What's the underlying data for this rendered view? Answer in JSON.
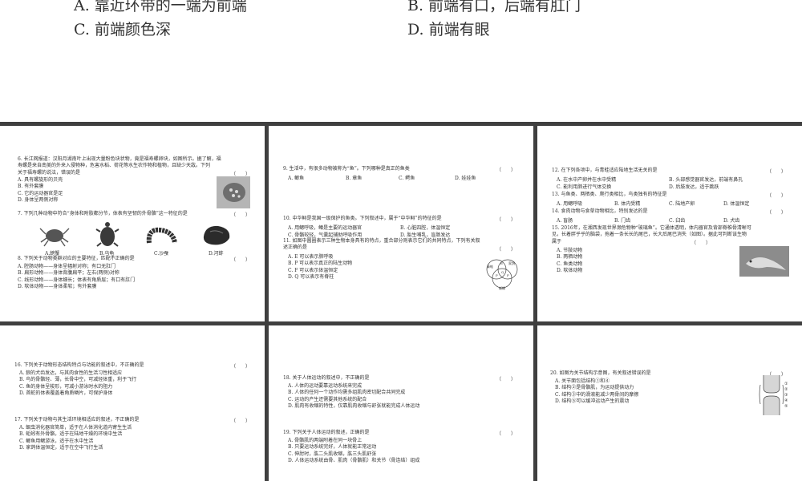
{
  "top": {
    "option_a": "A. 靠近环带的一端为前端",
    "option_b": "B. 前端有口，后端有肛门",
    "option_c": "C. 前端颜色深",
    "option_d": "D. 前端有眼"
  },
  "p1": {
    "q6": {
      "stem": [
        "6. 长江网报道：汉阳月湖南叶上出现大量粉色块状物，竟是福寿螺卵块，如图所示。据了解，福",
        "寿螺是来自南美的外来入侵物种，危害水稻、荷花等水生农作物和植物，且缺少天敌。下列",
        "关于福寿螺的说法，错误的是"
      ],
      "paren": "（　　）",
      "options": [
        "A. 具有螺旋形的贝壳",
        "B. 有外套膜",
        "C. 它的运动器官是足",
        "D. 身体呈两侧对称"
      ]
    },
    "q7": {
      "stem": "7. 下列几种动物中符合“身体和附肢都分节，体表有坚韧的外骨骼”这一特征的是",
      "paren": "（　　）",
      "captions": [
        "A.螃蟹",
        "B.乌龟",
        "C.沙蚕",
        "D.河蚌"
      ]
    },
    "q8": {
      "stem": "8. 下列关于动物类群对应的主要特征，匹配不正确的是",
      "paren": "（　　）",
      "options": [
        "A. 腔肠动物——身体呈辐射对称；有口无肛门",
        "B. 扁形动物——身体背腹扁平；左右(两侧)对称",
        "C. 线形动物——身体细长；体表有角质层；有口有肛门",
        "D. 软体动物——身体柔软；有外套膜"
      ]
    }
  },
  "p2": {
    "q9": {
      "stem": "9. 生活中，有很多动物被称为“鱼”。下列哪种是真正的鱼类",
      "paren": "（　　）",
      "options": [
        "A. 鲫鱼",
        "B. 章鱼",
        "C. 鳄鱼",
        "D. 娃娃鱼"
      ]
    },
    "q10": {
      "stem": "10. 中华鲟是我国一级保护的鱼类。下列叙述中，属于“中华鲟”的特征的是",
      "paren": "（　　）",
      "options": [
        "A. 用鳃呼吸，鳍是主要的运动器官",
        "B. 心脏四腔，体温恒定",
        "C. 骨骼较轻，气囊起辅助呼吸作用",
        "D. 胎生哺乳，盲肠发达"
      ]
    },
    "q11": {
      "stem": [
        "11. 如图中圆圈表示三种生物本身具有的特点，重合部分则表示它们的共同特点，下列有关叙",
        "述正确的是"
      ],
      "paren": "（　　）",
      "options": [
        "A. E 可以表示肺呼吸",
        "B. P 可以表示真正的陆生动物",
        "C. F 可以表示体温恒定",
        "D. Q 可以表示有脊柱"
      ],
      "venn_labels": [
        "青蛙",
        "家鸽",
        "蜥蜴",
        "E",
        "P",
        "Q",
        "F"
      ]
    }
  },
  "p3": {
    "q12": {
      "stem": "12. 在下列各项中，与青蛙适应陆地生活无关的是",
      "paren": "（　　）",
      "options": [
        "A. 在水中产卵并在水中受精",
        "B. 头部感觉器官发达，前端有鼻孔",
        "C. 能利用肺进行气体交换",
        "D. 后肢发达，适于跳跃"
      ]
    },
    "q13": {
      "stem": "13. 与鱼类、两栖类、爬行类相比，鸟类独有的特征是",
      "paren": "（　　）",
      "options": [
        "A. 用鳃呼吸",
        "B. 体内受精",
        "C. 陆地产卵",
        "D. 体温恒定"
      ]
    },
    "q14": {
      "stem": "14. 食肉动物与食草动物相比，特别发达的是",
      "paren": "（　　）",
      "options": [
        "A. 盲肠",
        "B. 门齿",
        "C. 臼齿",
        "D. 犬齿"
      ]
    },
    "q15": {
      "stem": [
        "15. 2016年，在湘西发现世界濒危物种“玻璃鱼”。它通体透明，体内器官及背部脊椎骨清晰可",
        "见，长着胖乎乎的脑袋，拖着一条长长的尾巴，长大后尾巴消失（如图）。据此可判断该生物",
        "属于"
      ],
      "paren": "（　　）",
      "options": [
        "A. 节肢动物",
        "B. 两栖动物",
        "C. 鱼类动物",
        "D. 软体动物"
      ]
    }
  },
  "p4": {
    "q16": {
      "stem": "16. 下列关于动物形态结构特点与功能的叙述中，不正确的是",
      "paren": "（　　）",
      "options": [
        "A. 狼的犬齿发达，与其肉食性的生活习性相适应",
        "B. 鸟的骨骼轻、薄，长骨中空，可减轻体重，利于飞行",
        "C. 鱼的身体呈梭形，可减小游泳时水的阻力",
        "D. 首蛇的体表覆盖着角质鳞片，可保护身体"
      ]
    },
    "q17": {
      "stem": "17. 下列关于动物与其生活环境相适应的叙述，不正确的是",
      "paren": "（　　）",
      "options": [
        "A. 蛔虫消化器官简单，适于在人体消化道内寄生生活",
        "B. 蚯蚓有外骨骼，适于在陆地干燥的环境中生活",
        "C. 鲫鱼用鳃游泳，适于在水中生活",
        "D. 家鸽体温恒定，适于在空中飞行生活"
      ]
    }
  },
  "p5": {
    "q18": {
      "stem": "18. 关于人体运动的叙述中，不正确的是",
      "paren": "（　　）",
      "options": [
        "A. 人体的运动要靠运动系统来完成",
        "B. 人体的任何一个动作均需多组肌肉密切配合共同完成",
        "C. 运动的产生还需要其他系统的配合",
        "D. 肌肉有收缩的特性，仅靠肌肉收缩与舒张就能完成人体运动"
      ]
    },
    "q19": {
      "stem": "19. 下列关于人体运动的叙述，正确的是",
      "paren": "（　　）",
      "options": [
        "A. 骨骼肌的两端附着在同一块骨上",
        "B. 只要运动系统完好，人体就能正常运动",
        "C. 伸肘时，肱二头肌收缩，肱三头肌舒张",
        "D. 人体运动系统由骨、肌肉（骨骼肌）和关节（骨连结）组成"
      ]
    }
  },
  "p6": {
    "q20": {
      "stem": "20. 如图为关节结构示意图，有关叙述错误的是",
      "paren": "（　　）",
      "options": [
        "A. 关节面包括结构①和④",
        "B. 结构②是骨骼肌，为运动提供动力",
        "C. 结构③中的滑液能减少两骨间的摩擦",
        "D. 结构⑤可以缓冲运动产生的震动"
      ],
      "figure_labels": [
        "①",
        "②",
        "③",
        "④",
        "⑤"
      ]
    }
  }
}
